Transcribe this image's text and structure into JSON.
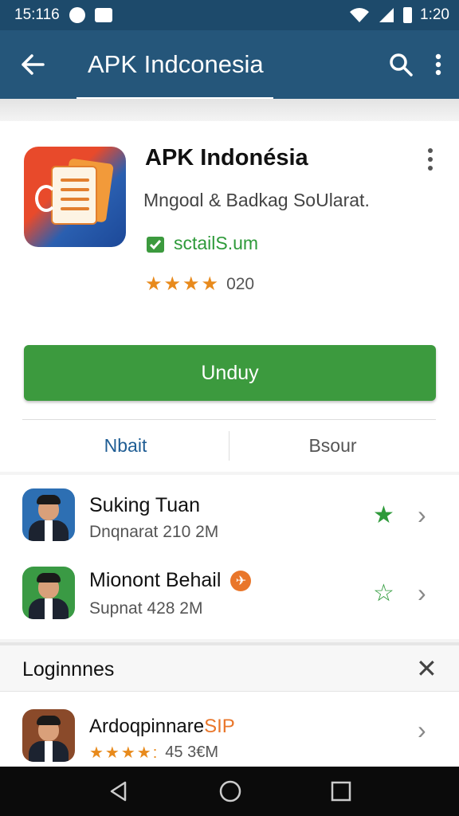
{
  "status_bar": {
    "time_left": "15:116",
    "time_right": "1:20"
  },
  "app_bar": {
    "title": "APK Indconesia"
  },
  "app": {
    "name": "APK Indonésia",
    "subtitle": "Mngoɑl & Badkag SoUlarat.",
    "developer": "sctailS.um",
    "stars": "★★★★",
    "rating_count": "020",
    "download_label": "Unduy"
  },
  "tabs": [
    {
      "label": "Nbait"
    },
    {
      "label": "Bsour"
    }
  ],
  "list": [
    {
      "title": "Suking Tuan",
      "meta": "Dnqnarat 210 2M"
    },
    {
      "title": "Mionont Behail",
      "meta": "Supnat 428 2M"
    }
  ],
  "section": {
    "title": "Loginnnes",
    "item": {
      "title_main": "Ardoqpinnare",
      "title_highlight": "SIP",
      "stars": "★★★★:",
      "meta": "45 3€M"
    }
  },
  "colors": {
    "app_bar": "#25567a",
    "status_bar": "#1d4a6b",
    "accent_green": "#3c9a3e",
    "star_orange": "#e88a1c",
    "tab_active": "#1f5d94"
  }
}
